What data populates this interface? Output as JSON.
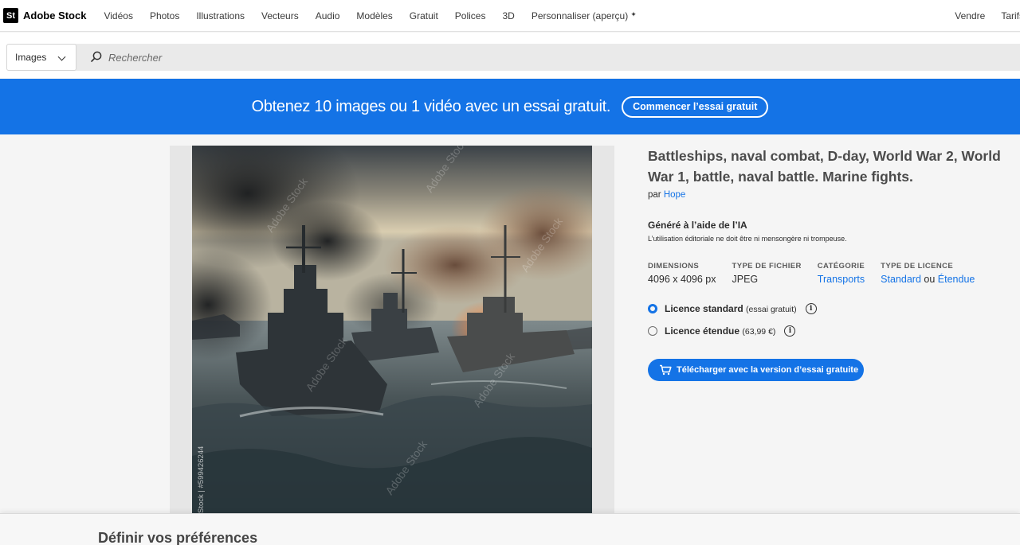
{
  "brand": {
    "logo": "St",
    "name": "Adobe Stock"
  },
  "nav": {
    "links": [
      "Vidéos",
      "Photos",
      "Illustrations",
      "Vecteurs",
      "Audio",
      "Modèles",
      "Gratuit",
      "Polices",
      "3D",
      "Personnaliser (aperçu)"
    ],
    "right": [
      "Vendre",
      "Tarifs"
    ]
  },
  "search": {
    "type": "Images",
    "placeholder": "Rechercher"
  },
  "banner": {
    "text": "Obtenez 10 images ou 1 vidéo avec un essai gratuit.",
    "button": "Commencer l’essai gratuit"
  },
  "image": {
    "watermark": "Adobe Stock",
    "id_label": "Stock | #599426244"
  },
  "asset": {
    "title": "Battleships, naval combat, D-day, World War 2, World War 1, battle, naval battle. Marine fights.",
    "by_prefix": "par",
    "author": "Hope",
    "ai_title": "Généré à l’aide de l’IA",
    "ai_note": "L’utilisation éditoriale ne doit être ni mensongère ni trompeuse."
  },
  "meta": {
    "dimensions": {
      "label": "DIMENSIONS",
      "value": "4096 x 4096 px"
    },
    "filetype": {
      "label": "TYPE DE FICHIER",
      "value": "JPEG"
    },
    "category": {
      "label": "CATÉGORIE",
      "value": "Transports"
    },
    "license": {
      "label": "TYPE DE LICENCE",
      "standard": "Standard",
      "or": "ou",
      "extended": "Étendue"
    }
  },
  "licenses": [
    {
      "name": "Licence standard",
      "detail": "(essai gratuit)",
      "selected": true
    },
    {
      "name": "Licence étendue",
      "detail": "(63,99 €)",
      "selected": false
    }
  ],
  "download_button": "Télécharger avec la version d’essai gratuite",
  "preferences": {
    "title": "Définir vos préférences"
  },
  "colors": {
    "accent": "#1473e6",
    "banner": "#1473e6"
  }
}
